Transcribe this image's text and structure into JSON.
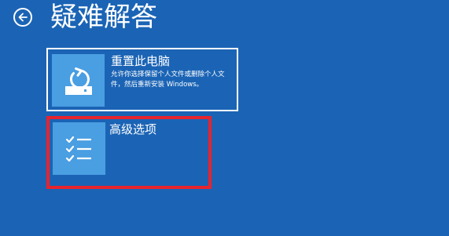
{
  "header": {
    "title": "疑难解答",
    "back_icon": "back-arrow-icon"
  },
  "options": [
    {
      "title": "重置此电脑",
      "description": "允许你选择保留个人文件或删除个人文件，然后重新安装 Windows。",
      "icon": "reset-pc-icon"
    },
    {
      "title": "高级选项",
      "icon": "checklist-icon"
    }
  ],
  "colors": {
    "background": "#1b64b5",
    "icon_tile": "#4a9ee2",
    "highlight_border": "#e8232d"
  }
}
